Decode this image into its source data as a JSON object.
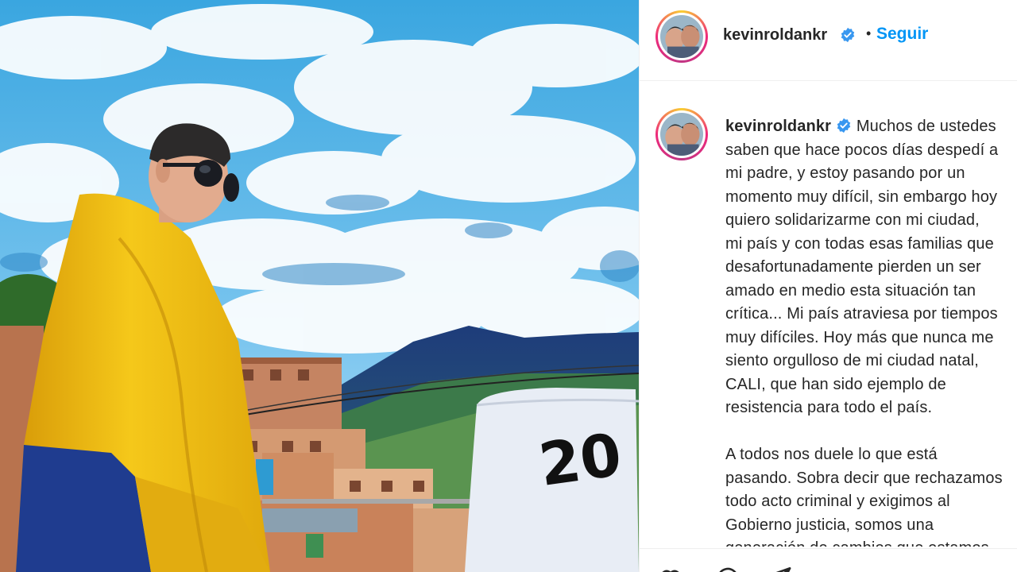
{
  "post": {
    "username": "kevinroldankr",
    "follow_label": "Seguir",
    "separator": "•",
    "caption_lines": [
      "Muchos de ustedes",
      "saben que hace pocos días despedí a",
      "mi padre, y estoy pasando por un",
      "momento muy difícil, sin embargo hoy",
      "quiero solidarizarme con mi ciudad,",
      "mi país y con todas esas familias que",
      "desafortunadamente pierden un ser",
      "amado en medio esta situación tan",
      "crítica... Mi país atraviesa por tiempos",
      "muy difíciles. Hoy más que nunca me",
      "siento orgulloso de mi ciudad natal,",
      "CALI, que han sido ejemplo de",
      "resistencia para todo el país."
    ],
    "caption_lines_2": [
      "A todos nos duele lo que está",
      "pasando. Sobra decir que rechazamos",
      "todo acto criminal y exigimos al",
      "Gobierno justicia, somos una",
      "generación de cambios que estamos"
    ],
    "photo_graffiti": "20"
  },
  "colors": {
    "follow": "#0095f6",
    "verified": "#3897f0",
    "text": "#262626",
    "flag_yellow": "#f2c40f",
    "flag_blue": "#1f3c8f"
  },
  "icons": [
    "verified-badge-icon",
    "heart-icon",
    "comment-icon",
    "share-icon"
  ]
}
